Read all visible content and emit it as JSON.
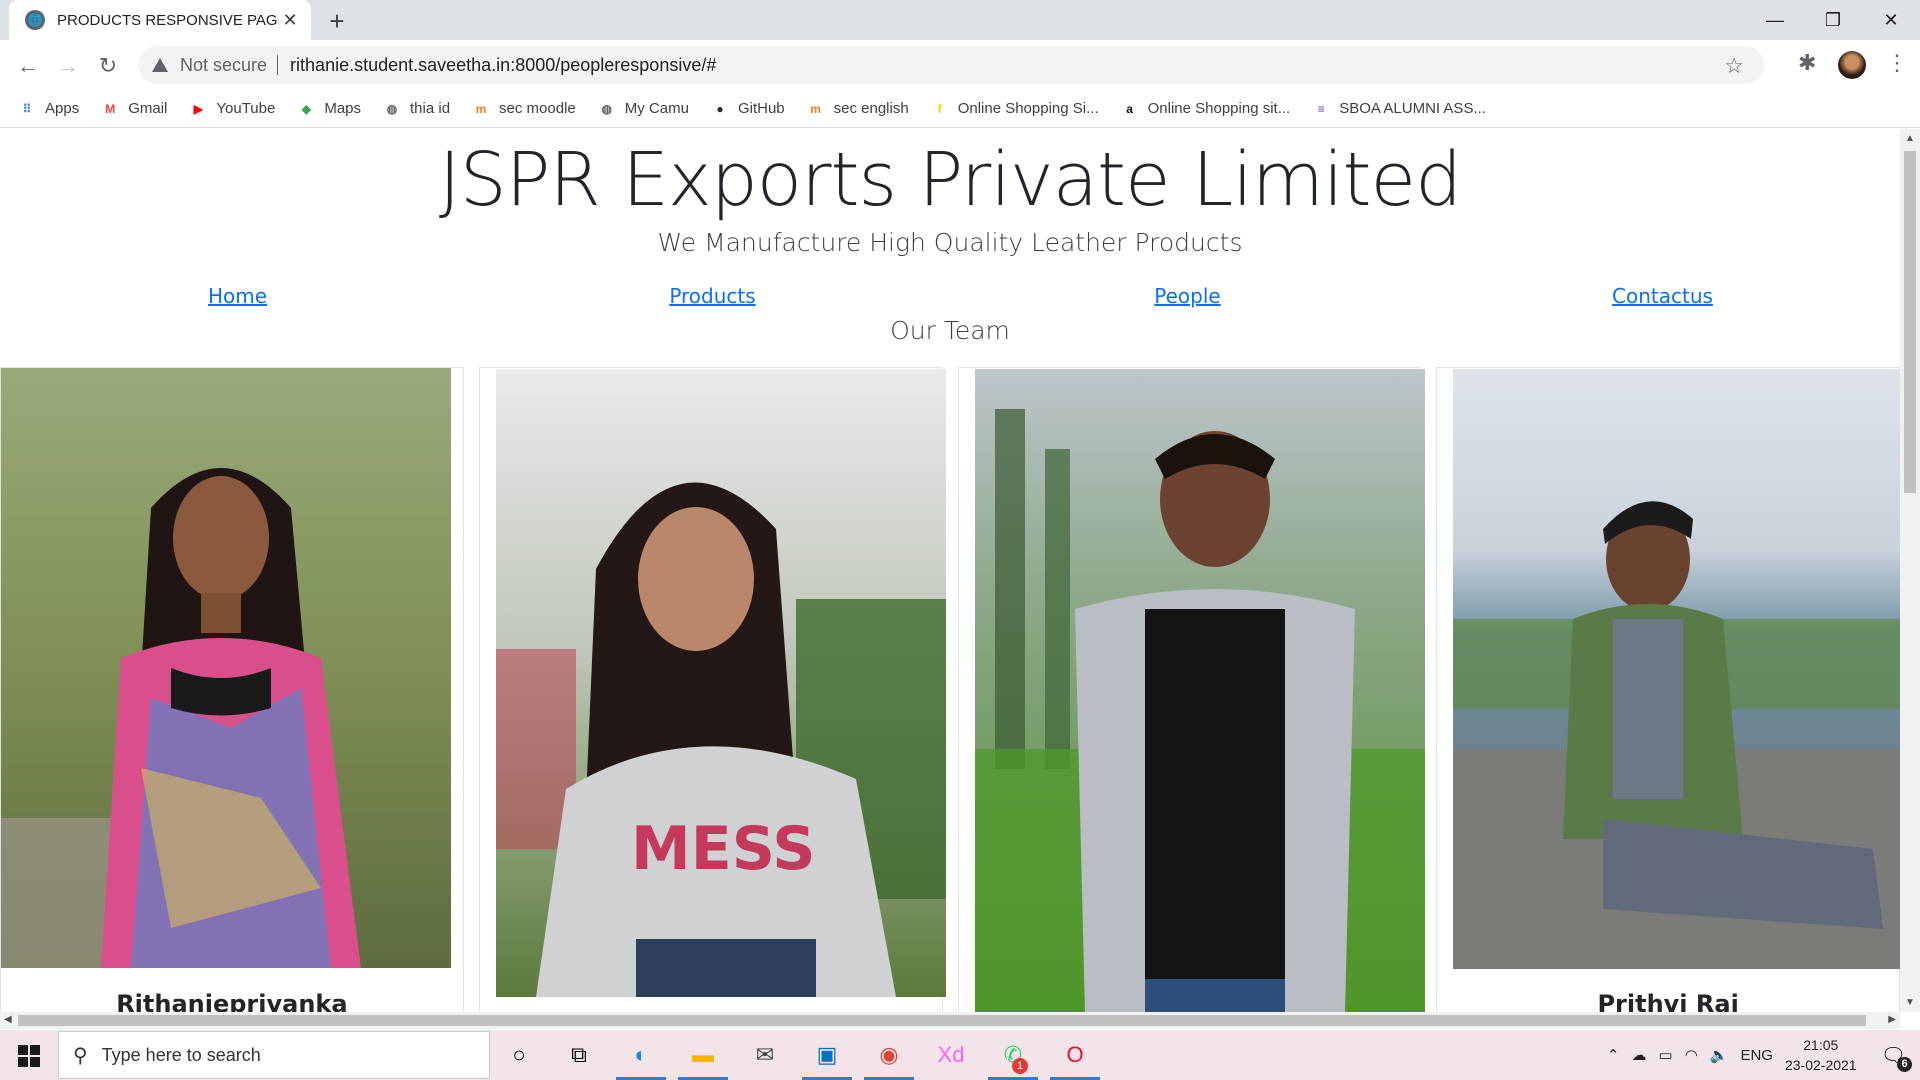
{
  "browser": {
    "tab_title": "PRODUCTS RESPONSIVE PAGE",
    "security_label": "Not secure",
    "url": "rithanie.student.saveetha.in:8000/peopleresponsive/#",
    "bookmarks": [
      {
        "label": "Apps",
        "icon": "apps-grid-icon",
        "color": "#4285f4"
      },
      {
        "label": "Gmail",
        "icon": "gmail-icon",
        "color": "#ea4335"
      },
      {
        "label": "YouTube",
        "icon": "youtube-icon",
        "color": "#ff0000"
      },
      {
        "label": "Maps",
        "icon": "maps-icon",
        "color": "#34a853"
      },
      {
        "label": "thia id",
        "icon": "globe-icon",
        "color": "#5f6368"
      },
      {
        "label": "sec moodle",
        "icon": "moodle-icon",
        "color": "#f98012"
      },
      {
        "label": "My Camu",
        "icon": "globe-icon",
        "color": "#5f6368"
      },
      {
        "label": "GitHub",
        "icon": "github-icon",
        "color": "#24292e"
      },
      {
        "label": "sec english",
        "icon": "moodle-icon",
        "color": "#f98012"
      },
      {
        "label": "Online Shopping Si...",
        "icon": "flipkart-icon",
        "color": "#f7d400"
      },
      {
        "label": "Online Shopping sit...",
        "icon": "amazon-icon",
        "color": "#111111"
      },
      {
        "label": "SBOA ALUMNI ASS...",
        "icon": "forms-icon",
        "color": "#673ab7"
      }
    ]
  },
  "page": {
    "company_name": "JSPR Exports Private Limited",
    "tagline": "We Manufacture High Quality Leather Products",
    "nav": [
      "Home",
      "Products",
      "People",
      "Contactus"
    ],
    "team_heading": "Our Team",
    "members": [
      {
        "name": "Rithanieprivanka",
        "photo": "woman-long-hair-floral-dress"
      },
      {
        "name": "",
        "photo": "woman-grey-mess-tshirt"
      },
      {
        "name": "",
        "photo": "man-black-tee-grey-hoodie"
      },
      {
        "name": "Prithvi Rai",
        "photo": "man-green-jacket-glasses"
      }
    ]
  },
  "taskbar": {
    "search_placeholder": "Type here to search",
    "language": "ENG",
    "time": "21:05",
    "date": "23-02-2021",
    "whatsapp_badge": "1",
    "notification_count": "6"
  }
}
